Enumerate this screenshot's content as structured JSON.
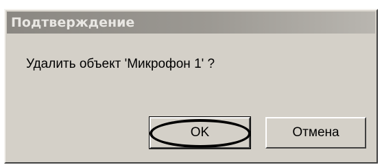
{
  "dialog": {
    "title": "Подтверждение",
    "message": "Удалить объект 'Микрофон 1' ?",
    "buttons": {
      "ok_label": "OK",
      "cancel_label": "Отмена"
    },
    "highlighted_button": "ok"
  },
  "colors": {
    "dialog_bg": "#d4d0c8",
    "title_bg": "#9c9993",
    "title_text": "#e9e7e3",
    "highlight_ring": "#000000"
  }
}
